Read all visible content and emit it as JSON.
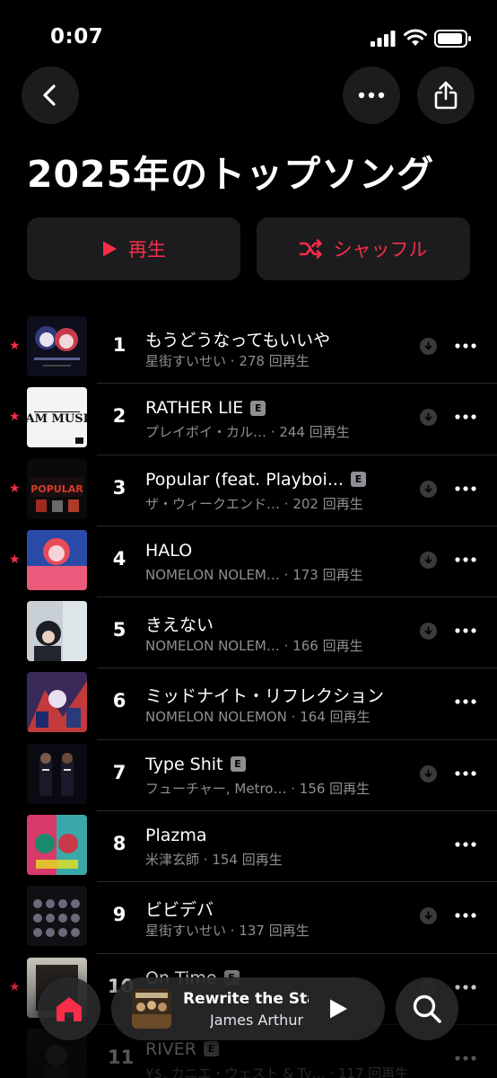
{
  "status_bar": {
    "time": "0:07"
  },
  "header": {
    "title": "2025年のトップソング"
  },
  "actions": {
    "play_label": "再生",
    "shuffle_label": "シャッフル"
  },
  "colors": {
    "accent": "#fa2d48",
    "background": "#000000",
    "card": "#1c1c1e",
    "secondary_text": "#8e8e93"
  },
  "tracks": [
    {
      "rank": "1",
      "title": "もうどうなってもいいや",
      "artist": "星街すいせい ·",
      "plays": "278 回再生",
      "starred": true,
      "explicit": false,
      "downloaded": true,
      "art": "art-1"
    },
    {
      "rank": "2",
      "title": "RATHER LIE",
      "artist": "プレイボイ・カル…",
      "plays": "· 244 回再生",
      "starred": true,
      "explicit": true,
      "downloaded": true,
      "art": "art-2"
    },
    {
      "rank": "3",
      "title": "Popular (feat. Playboi...",
      "artist": "ザ・ウィークエンド… ·",
      "plays": "202 回再生",
      "starred": true,
      "explicit": true,
      "downloaded": true,
      "art": "art-3"
    },
    {
      "rank": "4",
      "title": "HALO",
      "artist": "NOMELON NOLEM… ·",
      "plays": "173 回再生",
      "starred": true,
      "explicit": false,
      "downloaded": true,
      "art": "art-4"
    },
    {
      "rank": "5",
      "title": "きえない",
      "artist": "NOMELON NOLEM… ·",
      "plays": "166 回再生",
      "starred": false,
      "explicit": false,
      "downloaded": true,
      "art": "art-5"
    },
    {
      "rank": "6",
      "title": "ミッドナイト・リフレクション",
      "artist": "NOMELON NOLEMON ·",
      "plays": "164 回再生",
      "starred": false,
      "explicit": false,
      "downloaded": false,
      "art": "art-6"
    },
    {
      "rank": "7",
      "title": "Type Shit",
      "artist": "フューチャー, Metro… ·",
      "plays": "156 回再生",
      "starred": false,
      "explicit": true,
      "downloaded": true,
      "art": "art-7"
    },
    {
      "rank": "8",
      "title": "Plazma",
      "artist": "米津玄師 ·",
      "plays": "154 回再生",
      "starred": false,
      "explicit": false,
      "downloaded": false,
      "art": "art-8"
    },
    {
      "rank": "9",
      "title": "ビビデバ",
      "artist": "星街すいせい ·",
      "plays": "137 回再生",
      "starred": false,
      "explicit": false,
      "downloaded": true,
      "art": "art-9"
    },
    {
      "rank": "10",
      "title": "On Time",
      "artist": "",
      "plays": "",
      "starred": true,
      "explicit": true,
      "downloaded": true,
      "art": "art-10"
    },
    {
      "rank": "11",
      "title": "RIVER",
      "artist": "¥$, カニエ・ウェスト & Ty… ·",
      "plays": "117 回再生",
      "starred": false,
      "explicit": true,
      "downloaded": false,
      "art": "art-11"
    }
  ],
  "now_playing": {
    "title": "Rewrite the Stars",
    "artist": "James Arthur"
  },
  "icons": {
    "back": "chevron-left-icon",
    "more": "ellipsis-icon",
    "share": "share-icon",
    "play": "play-icon",
    "shuffle": "shuffle-icon",
    "home": "home-icon",
    "search": "search-icon"
  }
}
